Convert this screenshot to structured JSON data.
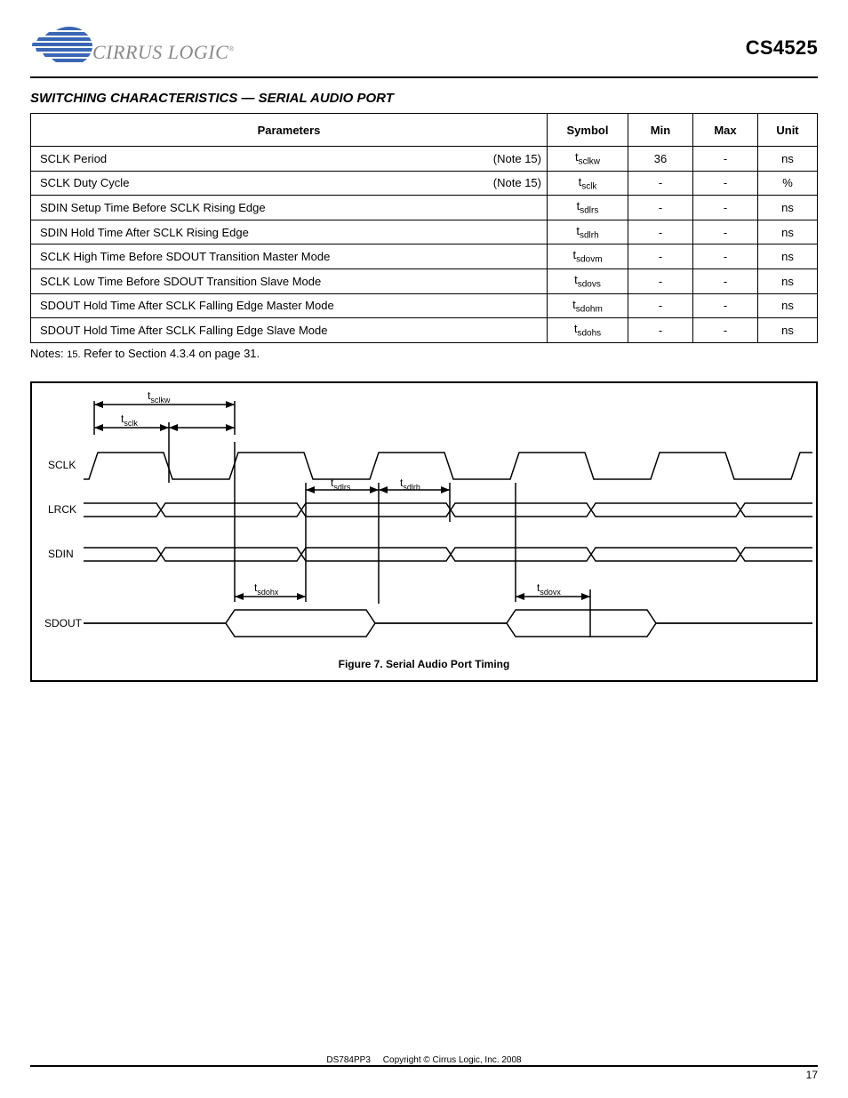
{
  "header": {
    "brand": "CIRRUS LOGIC",
    "part": "CS4525"
  },
  "section": {
    "title": "SWITCHING CHARACTERISTICS — SERIAL AUDIO PORT",
    "notes_label": "Notes:",
    "note_text": "Refer to Section 4.3.4 on page 31."
  },
  "table": {
    "head": [
      "Parameters",
      "Symbol",
      "Min",
      "Max",
      "Unit"
    ],
    "rows": [
      {
        "p": "SCLK Period",
        "note": "(Note 15)",
        "sym": "t_sclkw",
        "min": "36",
        "max": "-",
        "unit": "ns"
      },
      {
        "p": "SCLK Duty Cycle",
        "note": "(Note 15)",
        "sym": "t_sclk",
        "min": "-",
        "max": "-",
        "unit": "%"
      },
      {
        "p": "SDIN Setup Time Before SCLK Rising Edge",
        "note": "",
        "sym": "t_sdlrs",
        "min": "-",
        "max": "-",
        "unit": "ns"
      },
      {
        "p": "SDIN Hold Time After SCLK Rising Edge",
        "note": "",
        "sym": "t_sdlrh",
        "min": "-",
        "max": "-",
        "unit": "ns"
      },
      {
        "p": "SCLK High Time Before SDOUT Transition Master Mode",
        "note": "",
        "sym": "t_sdovm",
        "min": "-",
        "max": "-",
        "unit": "ns"
      },
      {
        "p": "SCLK Low Time Before SDOUT Transition Slave Mode",
        "note": "",
        "sym": "t_sdovs",
        "min": "-",
        "max": "-",
        "unit": "ns"
      },
      {
        "p": "SDOUT Hold Time After SCLK Falling Edge Master Mode",
        "note": "",
        "sym": "t_sdohm",
        "min": "-",
        "max": "-",
        "unit": "ns"
      },
      {
        "p": "SDOUT Hold Time After SCLK Falling Edge Slave Mode",
        "note": "",
        "sym": "t_sdohs",
        "min": "-",
        "max": "-",
        "unit": "ns"
      }
    ],
    "note_key": "15."
  },
  "diagram": {
    "signals": [
      "SCLK",
      "LRCK",
      "SDIN",
      "SDOUT"
    ],
    "tlabels": {
      "sclk": "t_sclk",
      "sclkw": "t_sclkw",
      "sdlrs": "t_sdlrs",
      "sdlrh": "t_sdlrh",
      "sdohx": "t_sdohx",
      "sdovx": "t_sdovx"
    },
    "caption": "Figure 7.  Serial Audio Port Timing"
  },
  "footer": {
    "copy": "Copyright © Cirrus Logic, Inc. 2008",
    "docnum": "DS784PP3",
    "page": "17"
  }
}
